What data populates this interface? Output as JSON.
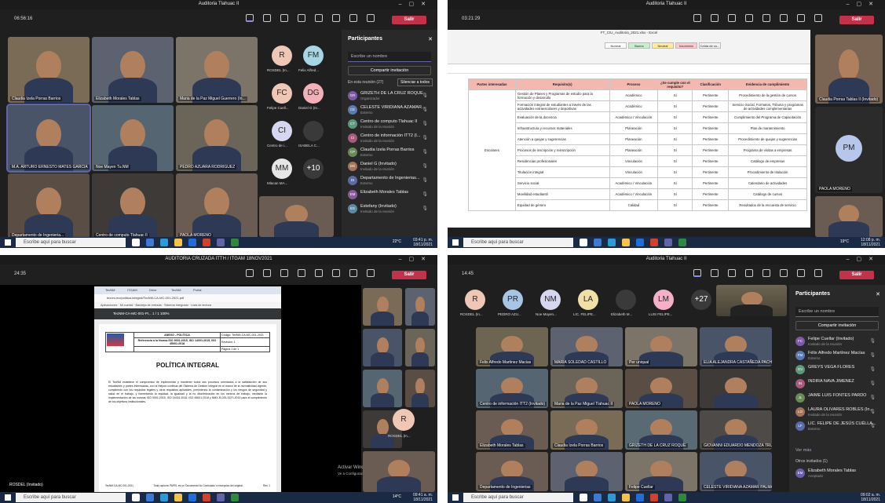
{
  "q1": {
    "title": "Auditoria Tlahuac II",
    "timer": "06:56:16",
    "leave_label": "Salir",
    "tiles": [
      {
        "name": "Claudia Izela Porras Barrios"
      },
      {
        "name": "Elizabeth Morales Tablas"
      },
      {
        "name": "Maria de la Paz Miguel Guerrero (In..."
      },
      {
        "name": "M.A. ARTURO ERNESTO MATES GARCIA"
      },
      {
        "name": "Noe Mayen Tu.NM"
      },
      {
        "name": "PEDRO AZUARA RODRIGUEZ"
      },
      {
        "name": "Departamento de Ingenieria..."
      },
      {
        "name": "Centro de computo Tlahuac II"
      },
      {
        "name": "PAOLA MORENO"
      }
    ],
    "avatars": [
      {
        "initials": "R",
        "name": "ROSDEL (In..."
      },
      {
        "initials": "FM",
        "name": "Felix Alfred..."
      },
      {
        "initials": "FC",
        "name": "Felipe Cuell..."
      },
      {
        "initials": "DG",
        "name": "Daniel G (In..."
      },
      {
        "initials": "CI",
        "name": "Centro de i..."
      },
      {
        "initials": "",
        "name": "ISABELA C..."
      },
      {
        "initials": "MM",
        "name": "Mlacan MA..."
      },
      {
        "initials": "+10",
        "name": ""
      }
    ],
    "panel": {
      "title": "Participantes",
      "search_placeholder": "Escribe un nombre",
      "invite_label": "Compartir invitación",
      "section_label": "En esta reunión (27)",
      "mute_all_label": "Silenciar a todos",
      "participants": [
        {
          "initials": "GR",
          "name": "GRIZETH DE LA CRUZ ROQUE",
          "sub": "Organizador"
        },
        {
          "initials": "CE",
          "name": "CELESTE VIRIDIANA AZAMAR...",
          "sub": "Externo"
        },
        {
          "initials": "CT",
          "name": "Centro de computo Tlahuac II",
          "sub": "Invitado de la reunión"
        },
        {
          "initials": "CI",
          "name": "Centro de información ITT2 (I...",
          "sub": "Invitado de la reunión"
        },
        {
          "initials": "CP",
          "name": "Claudia Izela Porras Barrios",
          "sub": "Externo"
        },
        {
          "initials": "DG",
          "name": "Daniel G (Invitado)",
          "sub": "Invitado de la reunión"
        },
        {
          "initials": "DI",
          "name": "Departamento de Ingenierias...",
          "sub": "Externo"
        },
        {
          "initials": "EM",
          "name": "Elizabeth Morales Tablas",
          "sub": ""
        },
        {
          "initials": "ES",
          "name": "Estefany (Invitado)",
          "sub": "Invitado de la reunión"
        }
      ]
    },
    "taskbar": {
      "search": "Escribe aquí para buscar",
      "time": "03:41 p. m.",
      "date": "18/11/2021",
      "weather": "22°C"
    }
  },
  "q2": {
    "title": "Auditoria Tlahuac II",
    "timer": "03:21:29",
    "leave_label": "Salir",
    "excel_title": "FT_CIU_Auditoria_2021.xlsx - Excel",
    "styles": [
      "Normal",
      "Bueno",
      "Neutral",
      "Incorrecto",
      "Celda de co..."
    ],
    "sheet": {
      "headers": [
        "Partes interesadas",
        "Requisito(s)",
        "Proceso",
        "¿Se cumple con el requisito?",
        "Clasificación",
        "Evidencia de cumplimiento"
      ],
      "group_label": "Escolares",
      "rows": [
        [
          "Gestión de Planes y Programas de estudio para la formación y desarrollo",
          "Académico",
          "Sí",
          "Pertinente",
          "Procedimiento de la gestión de cursos"
        ],
        [
          "Formación integral de estudiantes a través de las actividades extraescolares y deportivas",
          "Académico",
          "Sí",
          "Pertinente",
          "Servicio Social, Formatos, Tribuna y programas de actividades complementarias"
        ],
        [
          "Evaluación de la docencia",
          "Académico / Vinculación",
          "Sí",
          "Pertinente",
          "Cumplimiento del Programa de Capacitación"
        ],
        [
          "Infraestructura y recursos materiales",
          "Planeación",
          "Sí",
          "Pertinente",
          "Plan de mantenimiento"
        ],
        [
          "Atención a quejas y sugerencias",
          "Planeación",
          "Sí",
          "Pertinente",
          "Procedimiento de quejas y sugerencias"
        ],
        [
          "Procesos de inscripción y reinscripción",
          "Planeación",
          "Sí",
          "Pertinente",
          "Programa de visitas a empresas"
        ],
        [
          "Residencias profesionales",
          "Vinculación",
          "Sí",
          "Pertinente",
          "Catálogo de empresas"
        ],
        [
          "Titulación integral",
          "Vinculación",
          "Sí",
          "Pertinente",
          "Procedimiento de titulación"
        ],
        [
          "Servicio social",
          "Académico / Vinculación",
          "Sí",
          "Pertinente",
          "Calendario de actividades"
        ],
        [
          "Movilidad estudiantil",
          "Académico / Vinculación",
          "Sí",
          "Pertinente",
          "Catálogo de cursos"
        ],
        [
          "Equidad de género",
          "Calidad",
          "Sí",
          "Pertinente",
          "Resultados de la encuesta de servicio"
        ]
      ]
    },
    "tiles": [
      {
        "name": "Claudia Porras Tablas II (Invitado)"
      },
      {
        "initials": "PM",
        "name": "PAOLA MORENO"
      },
      {
        "name": ""
      }
    ],
    "taskbar": {
      "search": "Escribe aquí para buscar",
      "time": "12:08 p. m.",
      "date": "18/11/2021",
      "weather": "19°C"
    }
  },
  "q3": {
    "title": "AUDITORIA CRUZADA ITTH / ITGAM 18NOV2021",
    "timer": "24:35",
    "leave_label": "Salir",
    "pdf": {
      "tabs": [
        "TecNM",
        "ITGAM",
        "Drive",
        "TecNM",
        "Portal"
      ],
      "address": "tecnm.mx/politica-integral/TecNM-CA-MC-001-2021.pdf",
      "bookmarks": "Aplicaciones · Mi cuenta · Bandeja de entrada · Sistema Integrado · Lista de lectura",
      "toolbar": "TecNM-CA-MC-001-PI...   1 / 1   100%",
      "header_rows": [
        [
          "ANEXO - POLÍTICA",
          "Código: TecNM-CA-MC-001-2021"
        ],
        [
          "Referencia a la Norma ISO 9001:2015, ISO 14001:2015, ISO 45001:2018",
          "Revisión: 1"
        ],
        [
          "",
          "Página 1 de 1"
        ]
      ],
      "heading": "POLÍTICA INTEGRAL",
      "body": "El TecNM establece el compromiso de implementar y mantener todos sus procesos orientados a la satisfacción de sus estudiantes y partes interesadas, con la mejora continua del Sistema de Gestión Integral en el marco de la normatividad vigente, cumpliendo con los requisitos legales y otros requisitos aplicables, previniendo la contaminación y los riesgos de seguridad y salud en el trabajo, y fomentando la equidad, la igualdad y la no discriminación en los centros de trabajo, mediante la implementación de las normas ISO 9001:2015, ISO 14001:2015, ISO 45001:2018 y NMX-R-025-SCFI-2015 para el cumplimiento de los objetivos institucionales.",
      "footer_left": "TecNM-CA-MC-001-2021",
      "footer_mid": "Toda copia en PAPEL es un 'Documento No Controlado' a excepción del original.",
      "footer_right": "Rev. 1"
    },
    "watermark": [
      "Activar Windows",
      "Ve a Configuración para activar Windows."
    ],
    "avatar": {
      "initials": "R",
      "name": "ROSDEL (In..."
    },
    "bottom_name": "ROSDEL (Invitado)",
    "taskbar": {
      "search": "Escribe aquí para buscar",
      "time": "09:41 a. m.",
      "date": "18/11/2021",
      "weather": "14°C"
    }
  },
  "q4": {
    "title": "Auditoria Tlahuac II",
    "timer": "14:45",
    "leave_label": "Salir",
    "avatars": [
      {
        "initials": "R",
        "name": "ROSDEL (In..."
      },
      {
        "initials": "PR",
        "name": "PEDRO AZU..."
      },
      {
        "initials": "NM",
        "name": "Noe Mayen..."
      },
      {
        "initials": "LA",
        "name": "LIC. FELIPE..."
      },
      {
        "initials": "",
        "name": "Elizabeth M..."
      },
      {
        "initials": "LM",
        "name": "LUIS FELIPE..."
      },
      {
        "initials": "+27",
        "name": ""
      }
    ],
    "grid_names": [
      "Felix Alfredo Martinez Macias",
      "MARIA SOLEDAD CASTILLO",
      "Per uniqual",
      "ELIA ALEJANDRA CASTAÑEDA PACH...",
      "Centro de información ITT2 (Invitado)",
      "Maria de la Paz Miguel Tlahuac II",
      "PAOLA MORENO",
      "",
      "Elizabeth Morales Tablas",
      "Claudia Izela Porras Barrios",
      "GRIZETH DE LA CRUZ ROQUE",
      "GIOVANNI EDUARDO MENDOZA TRUJILLO",
      "Departamento de Ingenierias",
      "",
      "Felipe Cuellar",
      "CELESTE VIRIDIANA AZAMAR PALMA"
    ],
    "panel": {
      "title": "Participantes",
      "search_placeholder": "Escribe un nombre",
      "invite_label": "Compartir invitación",
      "participants": [
        {
          "initials": "FC",
          "name": "Felipe Cuellar (Invitado)",
          "sub": "Invitado de la reunión"
        },
        {
          "initials": "FM",
          "name": "Félix Alfredo Martínez Macías",
          "sub": "Externo"
        },
        {
          "initials": "GV",
          "name": "GREYS VEGA FLORES",
          "sub": ""
        },
        {
          "initials": "IN",
          "name": "INDIRA NAVA JIMENEZ",
          "sub": ""
        },
        {
          "initials": "JL",
          "name": "JAIME LUIS FONTES PARDO",
          "sub": ""
        },
        {
          "initials": "LO",
          "name": "LAURA OLIVARES ROBLES (In...",
          "sub": "Invitado de la reunión"
        },
        {
          "initials": "LF",
          "name": "LIC. FELIPE DE JESÚS CUÉLLA...",
          "sub": "Externo"
        }
      ],
      "see_more": "Ver más",
      "others_label": "Otros invitados (1)",
      "other": {
        "initials": "EM",
        "name": "Elizabeth Morales Tablas",
        "sub": "Aceptado"
      }
    },
    "taskbar": {
      "search": "Escribe aquí para buscar",
      "time": "09:02 a. m.",
      "date": "18/11/2021"
    }
  },
  "colors": {
    "teams_bg": "#1f1f1f",
    "leave_red": "#c4314b",
    "accent": "#6264a7",
    "taskbar": "#1a2a44"
  }
}
